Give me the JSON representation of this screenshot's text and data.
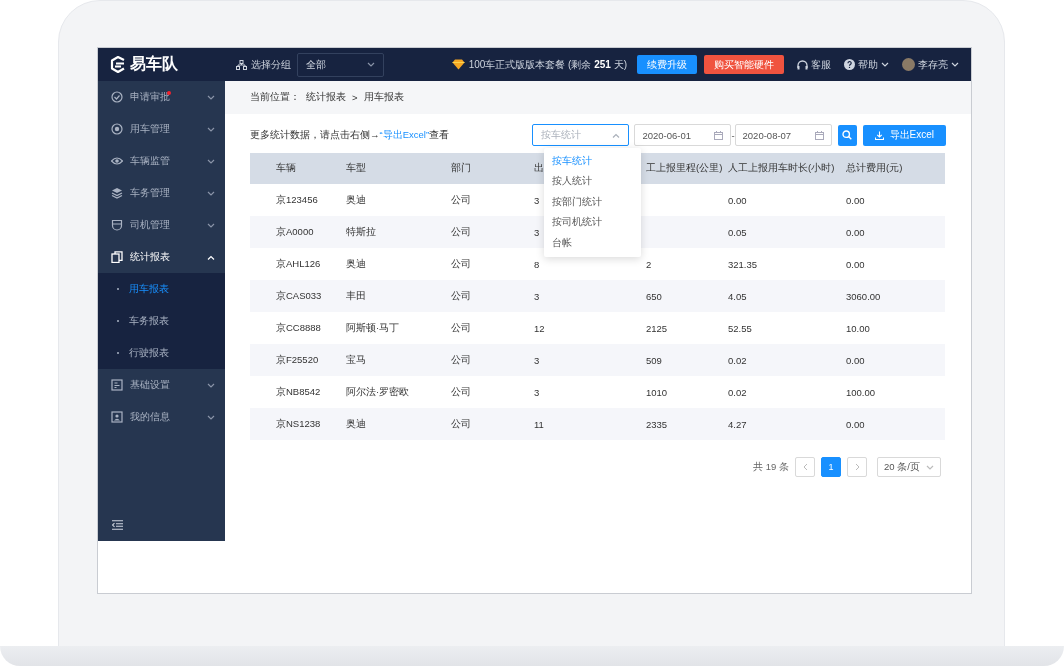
{
  "topbar": {
    "logo": "易车队",
    "group_label": "选择分组",
    "group_value": "全部",
    "plan_text": "100车正式版版本套餐 (剩余 **251** 天)",
    "upgrade_button": "续费升级",
    "hardware_button": "购买智能硬件",
    "service": "客服",
    "help": "帮助",
    "user": "李存亮"
  },
  "sidebar": {
    "items": [
      {
        "label": "申请审批",
        "kind": "check",
        "has_notice": true,
        "expanded": false
      },
      {
        "label": "用车管理",
        "kind": "target",
        "has_notice": false,
        "expanded": false
      },
      {
        "label": "车辆监管",
        "kind": "eye",
        "has_notice": false,
        "expanded": false
      },
      {
        "label": "车务管理",
        "kind": "layers",
        "has_notice": false,
        "expanded": false
      },
      {
        "label": "司机管理",
        "kind": "cup",
        "has_notice": false,
        "expanded": false
      },
      {
        "label": "统计报表",
        "kind": "copy",
        "has_notice": false,
        "expanded": true,
        "children": [
          {
            "label": "用车报表",
            "selected": true
          },
          {
            "label": "车务报表",
            "selected": false
          },
          {
            "label": "行驶报表",
            "selected": false
          }
        ]
      },
      {
        "label": "基础设置",
        "kind": "form",
        "has_notice": false,
        "expanded": false
      },
      {
        "label": "我的信息",
        "kind": "card",
        "has_notice": false,
        "expanded": false
      }
    ]
  },
  "breadcrumb": {
    "label": "当前位置：",
    "items": [
      "统计报表",
      "用车报表"
    ],
    "separator": ">"
  },
  "hint": {
    "text": "更多统计数据，请点击右侧→",
    "link": "“导出Excel”",
    "suffix": "查看"
  },
  "filters": {
    "type_select": {
      "placeholder": "按车统计",
      "open": true
    },
    "start_date": "2020-06-01",
    "separator": "-",
    "end_date": "2020-08-07",
    "export_button": "导出Excel"
  },
  "dropdown": {
    "options": [
      {
        "label": "按车统计",
        "selected": true
      },
      {
        "label": "按人统计",
        "selected": false
      },
      {
        "label": "按部门统计",
        "selected": false
      },
      {
        "label": "按司机统计",
        "selected": false
      },
      {
        "label": "台帐",
        "selected": false
      }
    ]
  },
  "table": {
    "columns": [
      "车辆",
      "车型",
      "部门",
      "出",
      "工上报里程(公里)",
      "人工上报用车时长(小时)",
      "总计费用(元)"
    ],
    "rows": [
      [
        "京123456",
        "奥迪",
        "公司",
        "3",
        null,
        "0.00",
        "0.00"
      ],
      [
        "京A0000",
        "特斯拉",
        "公司",
        "3",
        null,
        "0.05",
        "0.00"
      ],
      [
        "京AHL126",
        "奥迪",
        "公司",
        "8",
        "2",
        "321.35",
        "0.00"
      ],
      [
        "京CAS033",
        "丰田",
        "公司",
        "3",
        "650",
        "4.05",
        "3060.00"
      ],
      [
        "京CC8888",
        "阿斯顿·马丁",
        "公司",
        "12",
        "2125",
        "52.55",
        "10.00"
      ],
      [
        "京F25520",
        "宝马",
        "公司",
        "3",
        "509",
        "0.02",
        "0.00"
      ],
      [
        "京NB8542",
        "阿尔法·罗密欧",
        "公司",
        "3",
        "1010",
        "0.02",
        "100.00"
      ],
      [
        "京NS1238",
        "奥迪",
        "公司",
        "11",
        "2335",
        "4.27",
        "0.00"
      ]
    ]
  },
  "pagination": {
    "total": "共 19 条",
    "pages": [
      {
        "label": "1",
        "selected": true
      }
    ],
    "page_size": "20 条/页"
  }
}
